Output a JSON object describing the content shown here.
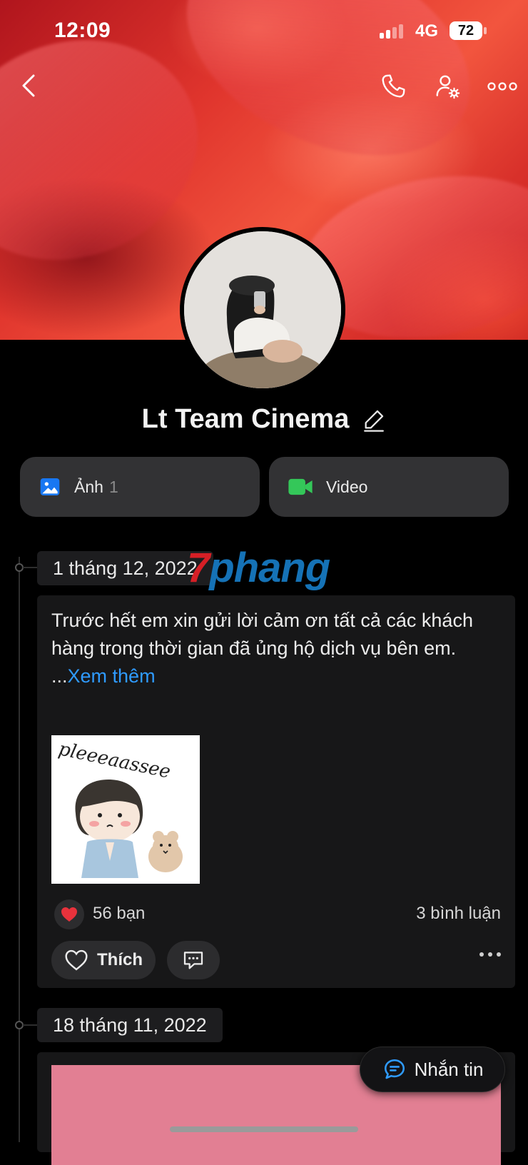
{
  "status_bar": {
    "time": "12:09",
    "network": "4G",
    "battery": "72"
  },
  "profile": {
    "name": "Lt Team Cinema"
  },
  "media": {
    "photos_label": "Ảnh",
    "photos_count": "1",
    "video_label": "Video"
  },
  "posts": [
    {
      "date": "1 tháng 12, 2022",
      "text": "Trước hết em xin gửi lời cảm ơn tất cả các khách hàng trong thời gian đã ủng hộ dịch vụ bên em.",
      "see_more_prefix": "...",
      "see_more": "Xem thêm",
      "sticker_text": "pleeeaassee",
      "likes": "56 bạn",
      "comments": "3 bình luận",
      "like_label": "Thích"
    },
    {
      "date": "18 tháng 11, 2022"
    }
  ],
  "watermark": {
    "part1": "7",
    "part2": "phang"
  },
  "fab": {
    "label": "Nhắn tin"
  },
  "colors": {
    "accent": "#2f9bff",
    "video_green": "#34c759",
    "photo_blue": "#1877f2",
    "heart": "#e8323c"
  }
}
